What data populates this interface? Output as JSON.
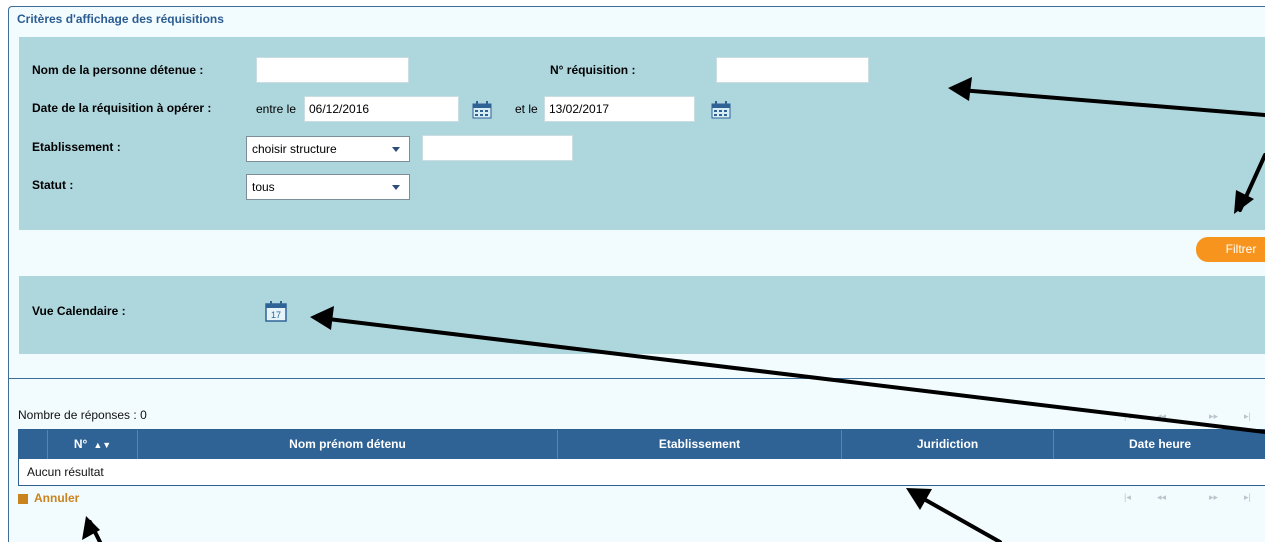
{
  "criteria": {
    "section_title": "Critères d'affichage des réquisitions",
    "nom_label": "Nom de la personne détenue :",
    "nom_value": "",
    "numero_label": "N° réquisition :",
    "numero_value": "",
    "date_label": "Date de la réquisition à opérer :",
    "entre_label": "entre le",
    "date_from": "06/12/2016",
    "etle_label": "et le",
    "date_to": "13/02/2017",
    "etablissement_label": "Etablissement :",
    "etablissement_select": "choisir structure",
    "etablissement_value": "",
    "statut_label": "Statut :",
    "statut_select": "tous"
  },
  "filter_button": "Filtrer",
  "calendar": {
    "label": "Vue Calendaire :",
    "icon_day": "17"
  },
  "results": {
    "count_label": "Nombre de réponses : 0",
    "columns": [
      "N°",
      "Nom prénom détenu",
      "Etablissement",
      "Juridiction",
      "Date heure"
    ],
    "empty_message": "Aucun résultat"
  },
  "pager": {
    "first": "|◂",
    "prev": "◂◂",
    "next": "▸▸",
    "last": "▸|"
  },
  "cancel_link": "Annuler",
  "colors": {
    "panel_bg": "#aed6dd",
    "header_bg": "#2f6396",
    "accent_orange": "#f7941d",
    "title_blue": "#2b5c92",
    "cancel_gold": "#c9841e"
  }
}
